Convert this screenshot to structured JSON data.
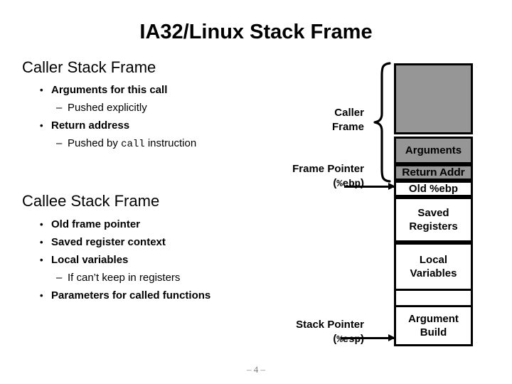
{
  "slide": {
    "title": "IA32/Linux Stack Frame",
    "page_number": "– 4 –"
  },
  "caller_section": {
    "heading": "Caller Stack Frame",
    "bullets": [
      {
        "level": 1,
        "text": "Arguments for this call"
      },
      {
        "level": 2,
        "text": "Pushed explicitly"
      },
      {
        "level": 1,
        "text": "Return address"
      },
      {
        "level": 2,
        "text": "Pushed by ",
        "mono": "call",
        "text_after": " instruction"
      }
    ]
  },
  "callee_section": {
    "heading": "Callee Stack Frame",
    "bullets": [
      {
        "level": 1,
        "text": "Old frame pointer"
      },
      {
        "level": 1,
        "text": "Saved register context"
      },
      {
        "level": 1,
        "text": "Local variables"
      },
      {
        "level": 2,
        "text": "If can’t keep in registers"
      },
      {
        "level": 1,
        "text": "Parameters for called functions"
      }
    ]
  },
  "diagram": {
    "caller_frame_label": "Caller\nFrame",
    "caller_frame_label_line1": "Caller",
    "caller_frame_label_line2": "Frame",
    "frame_pointer_label": "Frame Pointer",
    "frame_pointer_register": "%ebp",
    "stack_pointer_label": "Stack Pointer",
    "stack_pointer_register": "%esp",
    "paren_open": "(",
    "paren_close": ")",
    "boxes": [
      {
        "name": "caller-top",
        "label": "",
        "fill": "#969696"
      },
      {
        "name": "arguments",
        "label": "Arguments",
        "fill": "#969696"
      },
      {
        "name": "return-addr",
        "label": "Return Addr",
        "fill": "#969696"
      },
      {
        "name": "old-ebp",
        "label": "Old %ebp",
        "fill": "#ffffff"
      },
      {
        "name": "saved-regs",
        "label": "Saved\nRegisters",
        "fill": "#ffffff",
        "line1": "Saved",
        "line2": "Registers"
      },
      {
        "name": "local-vars",
        "label": "Local\nVariables",
        "fill": "#ffffff",
        "line1": "Local",
        "line2": "Variables"
      },
      {
        "name": "arg-build",
        "label": "Argument\nBuild",
        "fill": "#ffffff",
        "line1": "Argument",
        "line2": "Build"
      }
    ]
  },
  "colors": {
    "gray_fill": "#969696",
    "white_fill": "#ffffff",
    "stroke": "#000000",
    "footer_gray": "#808080"
  }
}
